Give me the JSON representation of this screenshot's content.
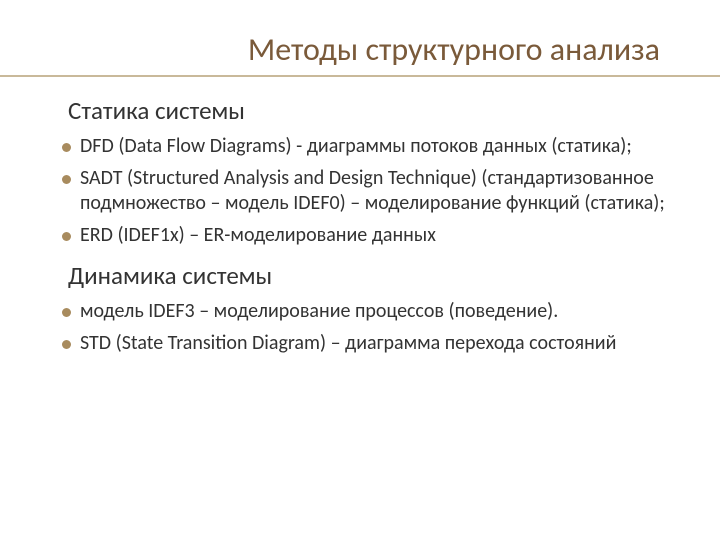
{
  "title": "Методы структурного анализа",
  "sections": [
    {
      "heading": "Статика системы",
      "items": [
        "DFD (Data Flow Diagrams) - диаграммы потоков данных (статика);",
        "SADT (Structured Analysis and Design Technique) (стандартизованное подмножество – модель IDEF0) – моделирование функций (статика);",
        "ERD (IDEF1x) – ER-моделирование данных"
      ]
    },
    {
      "heading": "Динамика системы",
      "items": [
        "модель IDEF3 – моделирование процессов (поведение).",
        "STD (State Transition Diagram) – диаграмма перехода состояний"
      ]
    }
  ]
}
